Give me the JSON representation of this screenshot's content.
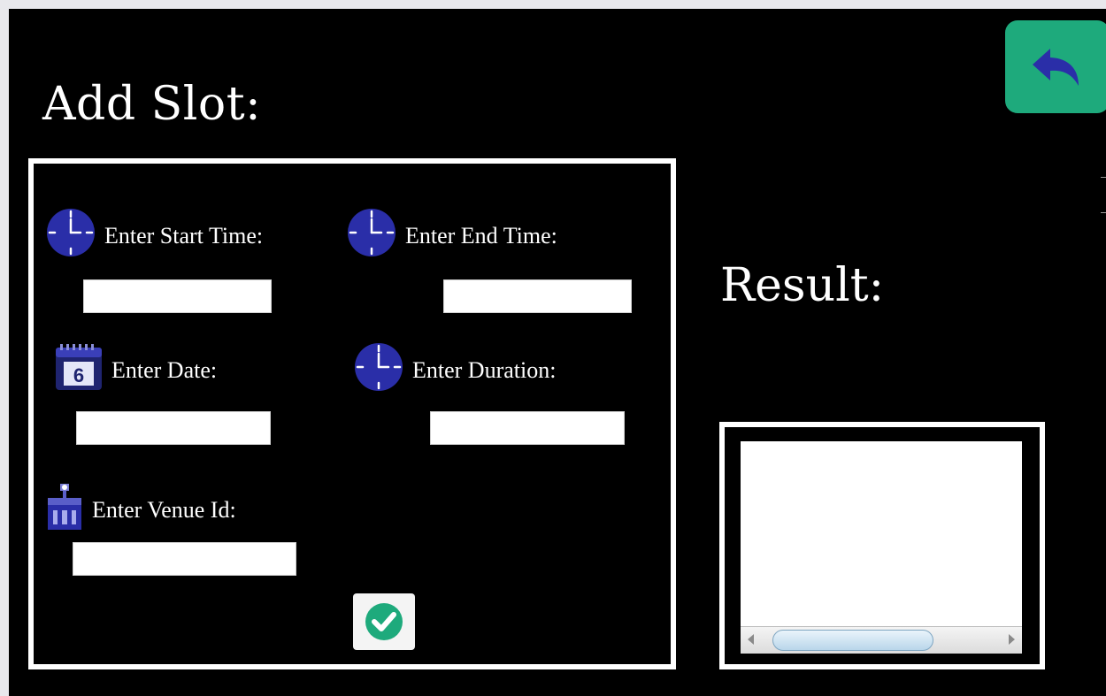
{
  "window": {
    "title": "Add Slot:",
    "back_icon": "undo-arrow-icon",
    "back_button_color": "#1eaa7c",
    "icon_color": "#2a2ea8"
  },
  "form": {
    "start_time": {
      "label": "Enter Start Time:",
      "icon": "clock-icon",
      "value": ""
    },
    "end_time": {
      "label": "Enter End Time:",
      "icon": "clock-icon",
      "value": ""
    },
    "date": {
      "label": "Enter Date:",
      "icon": "calendar-icon",
      "calendar_day": "6",
      "value": ""
    },
    "duration": {
      "label": "Enter Duration:",
      "icon": "clock-icon",
      "value": ""
    },
    "venue_id": {
      "label": "Enter Venue Id:",
      "icon": "building-icon",
      "value": ""
    },
    "submit_icon": "checkmark-icon",
    "submit_color": "#1eaa7c"
  },
  "result": {
    "title": "Result:",
    "content": ""
  }
}
